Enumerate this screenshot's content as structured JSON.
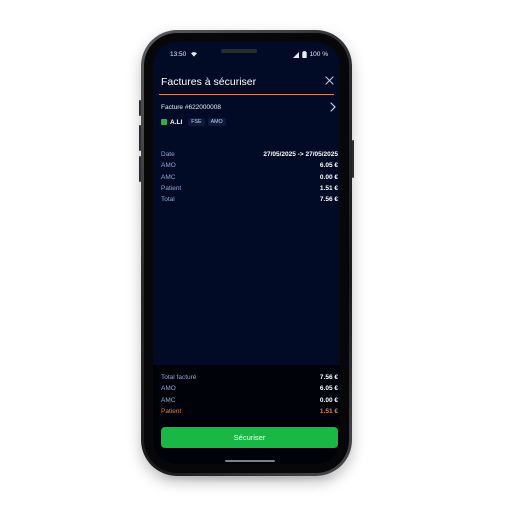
{
  "status_bar": {
    "time": "13:50",
    "battery": "100 %"
  },
  "header": {
    "title": "Factures à sécuriser"
  },
  "invoice": {
    "number": "Facture #622000008",
    "patient_name": "A.LI",
    "tags": [
      "FSE",
      "AMO"
    ]
  },
  "details": {
    "rows": [
      {
        "label": "Date",
        "value": "27/05/2025 -> 27/05/2025"
      },
      {
        "label": "AMO",
        "value": "6.05 €"
      },
      {
        "label": "AMC",
        "value": "0.00 €"
      },
      {
        "label": "Patient",
        "value": "1.51 €"
      },
      {
        "label": "Total",
        "value": "7.56 €"
      }
    ]
  },
  "totals": {
    "rows": [
      {
        "label": "Total facturé",
        "value": "7.56 €"
      },
      {
        "label": "AMO",
        "value": "6.05 €"
      },
      {
        "label": "AMC",
        "value": "0.00 €"
      },
      {
        "label": "Patient",
        "value": "1.51 €"
      }
    ]
  },
  "actions": {
    "secure_label": "Sécuriser"
  },
  "colors": {
    "background": "#010b26",
    "accent_orange": "#d8835c",
    "button_green": "#19b845",
    "label_blue": "#8ea8d4"
  }
}
